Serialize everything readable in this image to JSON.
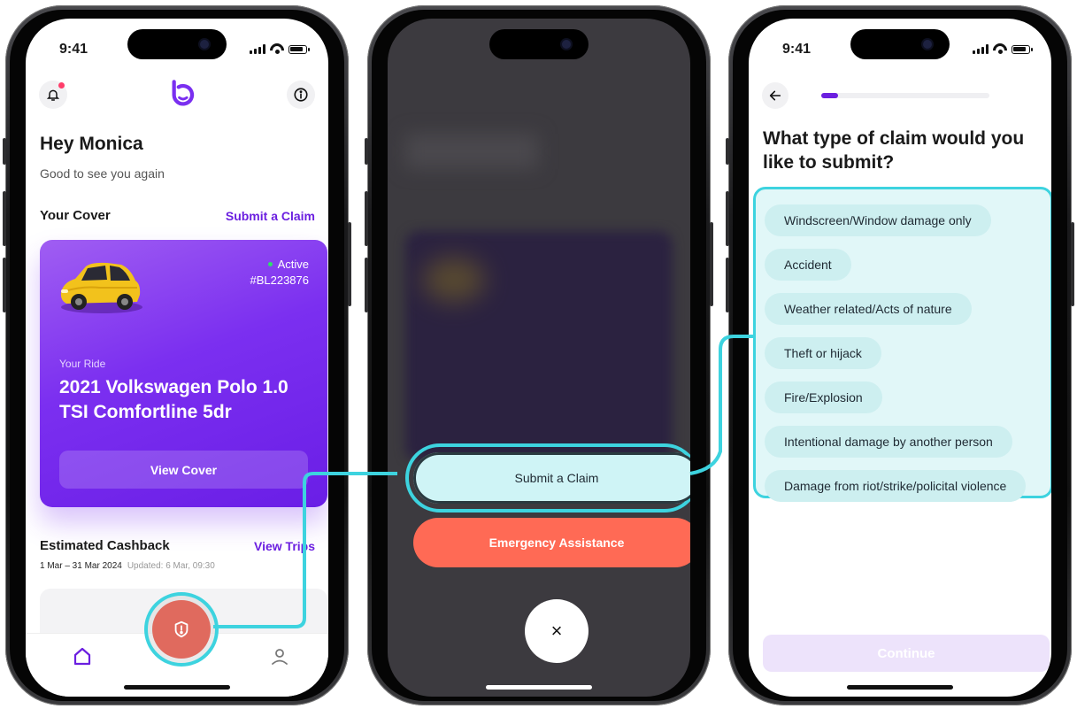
{
  "status": {
    "time": "9:41"
  },
  "home": {
    "greeting": "Hey Monica",
    "subtitle": "Good to see you again",
    "cover_title": "Your Cover",
    "submit_claim_link": "Submit a Claim",
    "card": {
      "status": "Active",
      "policy_number": "#BL223876",
      "ride_label": "Your Ride",
      "ride_name": "2021 Volkswagen Polo 1.0 TSI Comfortline 5dr",
      "view_cover_label": "View Cover"
    },
    "cashback_title": "Estimated Cashback",
    "view_trips_link": "View Trips",
    "period": "1 Mar – 31 Mar 2024",
    "updated": "Updated: 6 Mar, 09:30"
  },
  "action_sheet": {
    "submit_claim": "Submit a Claim",
    "emergency": "Emergency Assistance",
    "close_glyph": "×"
  },
  "claim_type": {
    "question": "What type of claim would you like to submit?",
    "progress": 0.1,
    "options": [
      "Windscreen/Window damage only",
      "Accident",
      "Weather related/Acts of nature",
      "Theft or hijack",
      "Fire/Explosion",
      "Intentional damage by another person",
      "Damage from riot/strike/policital violence"
    ],
    "continue_label": "Continue"
  },
  "colors": {
    "brand_purple": "#6b1fe0",
    "highlight_cyan": "#3dd3df",
    "emergency_red": "#ff6a55",
    "fab_red": "#e06a5e"
  }
}
